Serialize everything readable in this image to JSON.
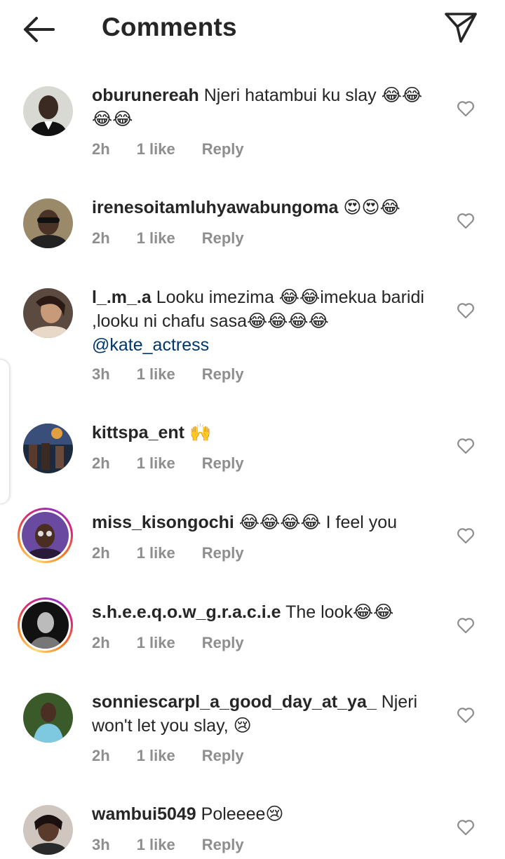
{
  "header": {
    "title": "Comments"
  },
  "comments": [
    {
      "username": "oburunereah",
      "text": "Njeri hatambui ku slay 😂😂😂😂",
      "time": "2h",
      "likes": "1 like",
      "reply": "Reply"
    },
    {
      "username": "irenesoitamluhyawabungoma",
      "text": "😍😍😂",
      "time": "2h",
      "likes": "1 like",
      "reply": "Reply"
    },
    {
      "username": "l_.m_.a",
      "text": "Looku imezima 😂😂imekua baridi ,looku ni chafu sasa😂😂😂😂",
      "mention": "@kate_actress",
      "time": "3h",
      "likes": "1 like",
      "reply": "Reply"
    },
    {
      "username": "kittspa_ent",
      "text": "🙌",
      "time": "2h",
      "likes": "1 like",
      "reply": "Reply"
    },
    {
      "username": "miss_kisongochi",
      "text": "😂😂😂😂 I feel you",
      "time": "2h",
      "likes": "1 like",
      "reply": "Reply"
    },
    {
      "username": "s.h.e.e.q.o.w_g.r.a.c.i.e",
      "text": "The look😂😂",
      "time": "2h",
      "likes": "1 like",
      "reply": "Reply"
    },
    {
      "username": "sonniescarpl_a_good_day_at_ya_",
      "text": "Njeri won't let you slay, 😢",
      "time": "2h",
      "likes": "1 like",
      "reply": "Reply"
    },
    {
      "username": "wambui5049",
      "text": "Poleeee😢",
      "time": "3h",
      "likes": "1 like",
      "reply": "Reply"
    }
  ]
}
